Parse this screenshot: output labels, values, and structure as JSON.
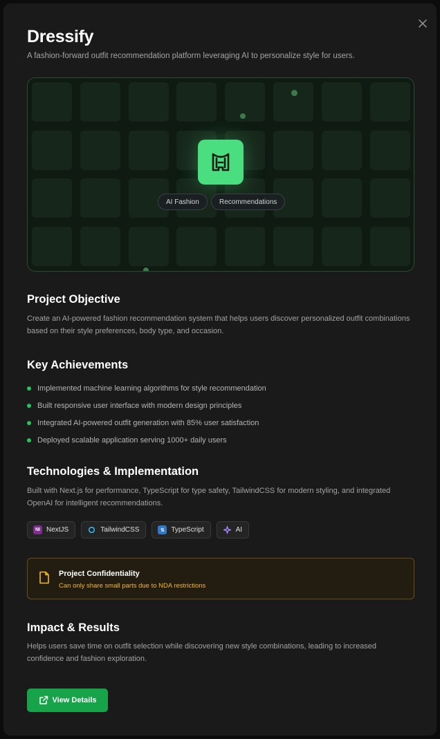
{
  "project": {
    "title": "Dressify",
    "subtitle": "A fashion-forward outfit recommendation platform leveraging AI to personalize style for users."
  },
  "hero": {
    "icon": "hanger-outfit-icon",
    "accent": "#4ade80",
    "tags": [
      "AI Fashion",
      "Recommendations"
    ]
  },
  "objective": {
    "heading": "Project Objective",
    "text": "Create an AI-powered fashion recommendation system that helps users discover personalized outfit combinations based on their style preferences, body type, and occasion."
  },
  "achievements": {
    "heading": "Key Achievements",
    "items": [
      "Implemented machine learning algorithms for style recommendation",
      "Built responsive user interface with modern design principles",
      "Integrated AI-powered outfit generation with 85% user satisfaction",
      "Deployed scalable application serving 1000+ daily users"
    ]
  },
  "technologies": {
    "heading": "Technologies & Implementation",
    "text": "Built with Next.js for performance, TypeScript for type safety, TailwindCSS for modern styling, and integrated OpenAI for intelligent recommendations.",
    "badges": [
      {
        "label": "NextJS",
        "icon": "nextjs-icon"
      },
      {
        "label": "TailwindCSS",
        "icon": "tailwind-icon"
      },
      {
        "label": "TypeScript",
        "icon": "typescript-icon"
      },
      {
        "label": "AI",
        "icon": "ai-sparkle-icon"
      }
    ]
  },
  "notice": {
    "title": "Project Confidentiality",
    "text": "Can only share small parts due to NDA restrictions",
    "color": "#f5b921"
  },
  "impact": {
    "heading": "Impact & Results",
    "text": "Helps users save time on outfit selection while discovering new style combinations, leading to increased confidence and fashion exploration."
  },
  "actions": {
    "view_details": "View Details"
  }
}
